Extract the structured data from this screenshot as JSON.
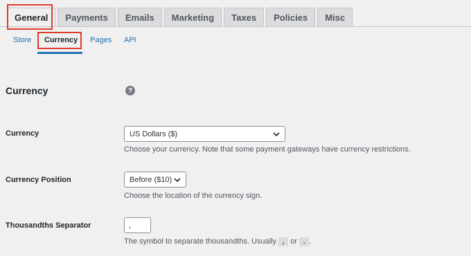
{
  "tabs": [
    "General",
    "Payments",
    "Emails",
    "Marketing",
    "Taxes",
    "Policies",
    "Misc"
  ],
  "subnav": {
    "store": "Store",
    "currency": "Currency",
    "pages": "Pages",
    "api": "API"
  },
  "section": {
    "title": "Currency",
    "help": "?"
  },
  "fields": {
    "currency": {
      "label": "Currency",
      "value": "US Dollars ($)",
      "description": "Choose your currency. Note that some payment gateways have currency restrictions."
    },
    "position": {
      "label": "Currency Position",
      "value": "Before ($10)",
      "description": "Choose the location of the currency sign."
    },
    "thousands": {
      "label": "Thousandths Separator",
      "value": ",",
      "description_prefix": "The symbol to separate thousandths. Usually",
      "comma": ",",
      "or": "or",
      "dot": ".",
      "suffix": "."
    }
  },
  "colors": {
    "accent": "#2271b1",
    "highlight": "#e03a2b"
  }
}
